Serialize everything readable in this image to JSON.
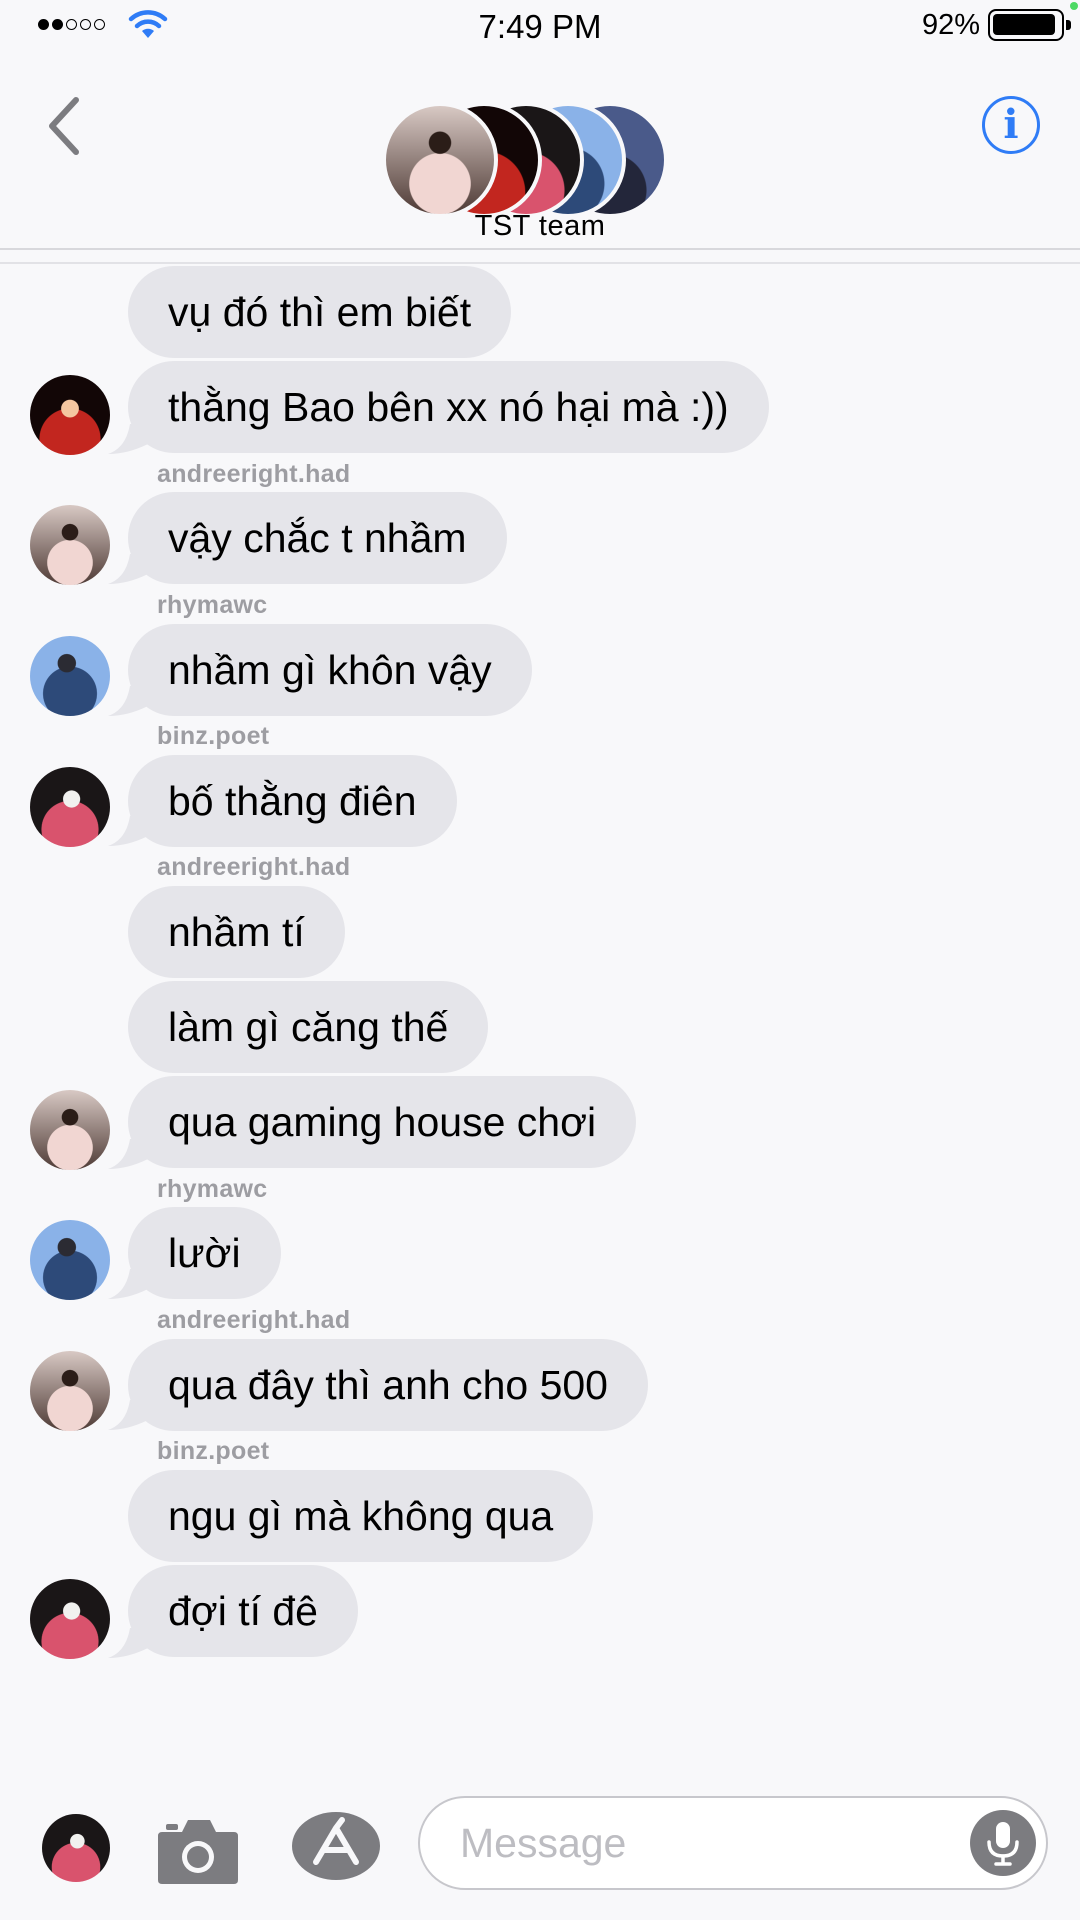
{
  "status_bar": {
    "time": "7:49 PM",
    "battery_percent": "92%",
    "battery_level": 0.92,
    "signal_bars": 2
  },
  "header": {
    "group_name": "TST team",
    "info_glyph": "i",
    "accent_color": "#2f7cf6"
  },
  "messages": [
    {
      "sender": "",
      "text": "vụ đó thì em biết",
      "avatar": false
    },
    {
      "sender": "",
      "text": "thằng Bao bên xx nó hại mà :))",
      "avatar": true
    },
    {
      "sender": "andreeright.had",
      "text": "vậy chắc t nhầm",
      "avatar": true
    },
    {
      "sender": "rhymawc",
      "text": "nhầm gì khôn vậy",
      "avatar": true
    },
    {
      "sender": "binz.poet",
      "text": "bố thằng điên",
      "avatar": true
    },
    {
      "sender": "andreeright.had",
      "text": "nhầm tí",
      "avatar": false
    },
    {
      "sender": "",
      "text": "làm gì căng thế",
      "avatar": false
    },
    {
      "sender": "",
      "text": "qua gaming house chơi",
      "avatar": true
    },
    {
      "sender": "rhymawc",
      "text": "lười",
      "avatar": true
    },
    {
      "sender": "andreeright.had",
      "text": "qua đây thì anh cho 500",
      "avatar": true
    },
    {
      "sender": "binz.poet",
      "text": "ngu gì mà không qua",
      "avatar": false
    },
    {
      "sender": "",
      "text": "đợi tí đê",
      "avatar": true
    }
  ],
  "composer": {
    "placeholder": "Message",
    "icons": [
      "camera-icon",
      "app-store-icon",
      "microphone-icon"
    ]
  },
  "colors": {
    "bubble_gray": "#e5e5ea",
    "background": "#f8f8fa",
    "sender_gray": "#9d9da2"
  }
}
